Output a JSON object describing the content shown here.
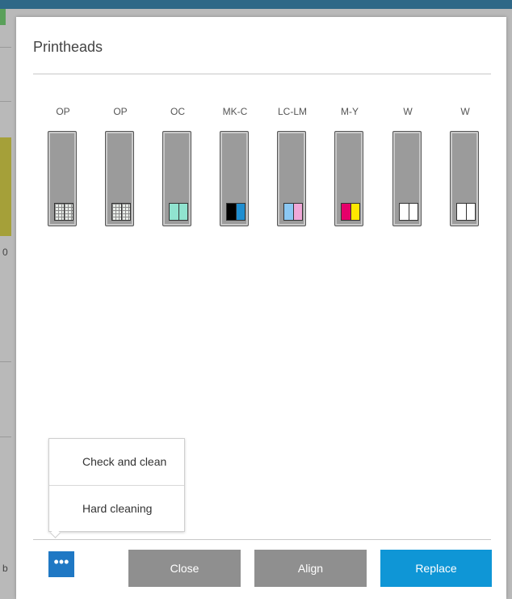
{
  "dialog": {
    "title": "Printheads",
    "printheads": [
      {
        "label": "OP",
        "slots": [
          "grid",
          "grid"
        ]
      },
      {
        "label": "OP",
        "slots": [
          "grid",
          "grid"
        ]
      },
      {
        "label": "OC",
        "slots": [
          "#90e3cf",
          "#90e3cf"
        ]
      },
      {
        "label": "MK-C",
        "slots": [
          "#000000",
          "#1f8ed0"
        ]
      },
      {
        "label": "LC-LM",
        "slots": [
          "#8bc8f3",
          "#f0a8d8"
        ]
      },
      {
        "label": "M-Y",
        "slots": [
          "#e5006a",
          "#ffe600"
        ]
      },
      {
        "label": "W",
        "slots": [
          "#ffffff",
          "#ffffff"
        ]
      },
      {
        "label": "W",
        "slots": [
          "#ffffff",
          "#ffffff"
        ]
      }
    ],
    "menu": {
      "items": [
        "Check and clean",
        "Hard cleaning"
      ]
    },
    "buttons": {
      "more": "•••",
      "close": "Close",
      "align": "Align",
      "replace": "Replace"
    },
    "colors": {
      "accent": "#0f96d6",
      "more_button": "#1f78c4",
      "secondary_button": "#8f8f8f"
    }
  },
  "background": {
    "fragments": [
      "0",
      "b"
    ]
  }
}
